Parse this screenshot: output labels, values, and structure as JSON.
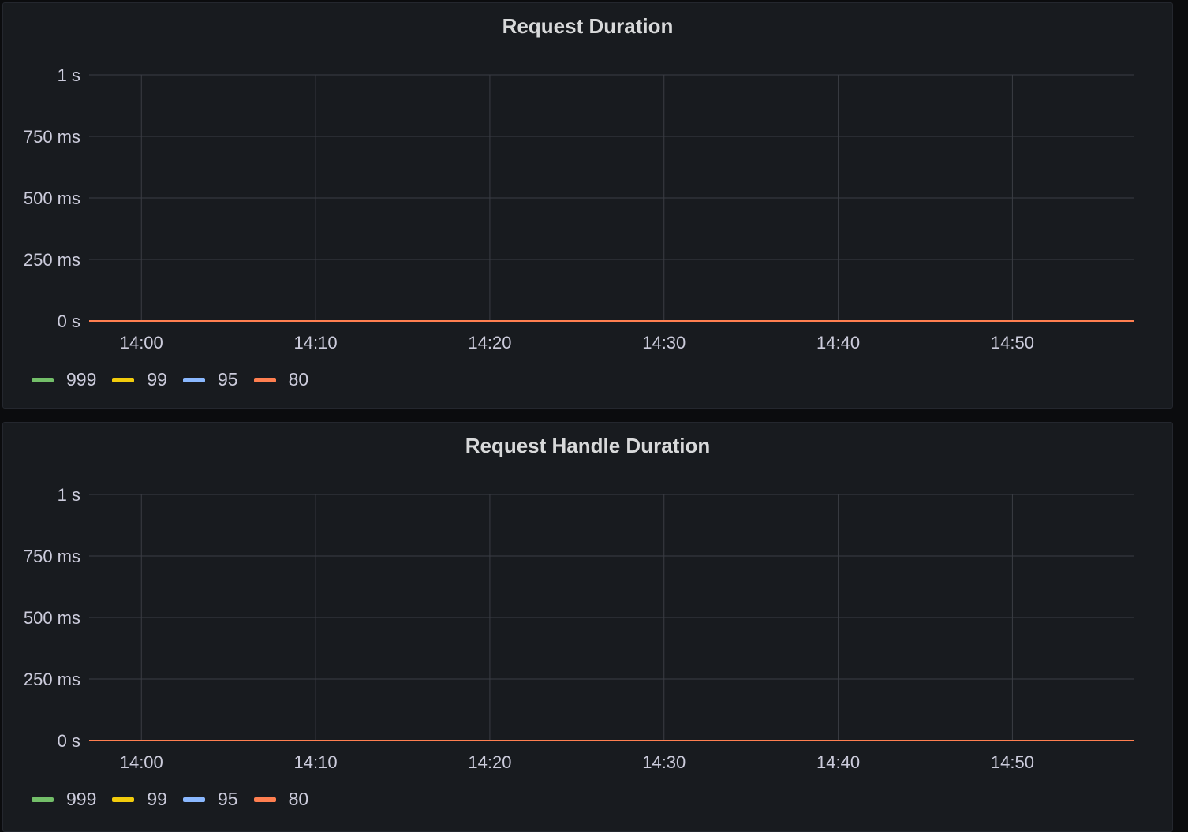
{
  "colors": {
    "background": "#0b0c0e",
    "panel_bg": "#181b1f",
    "grid": "#3a3d44",
    "text": "#ccccdc",
    "title": "#d8d9da"
  },
  "chart_data": [
    {
      "type": "line",
      "title": "Request Duration",
      "xlabel": "",
      "ylabel": "",
      "x_ticks": [
        "14:00",
        "14:10",
        "14:20",
        "14:30",
        "14:40",
        "14:50"
      ],
      "y_ticks": [
        "0 s",
        "250 ms",
        "500 ms",
        "750 ms",
        "1 s"
      ],
      "ylim": [
        0,
        1
      ],
      "x_range": [
        "13:57",
        "14:57"
      ],
      "grid": true,
      "legend_position": "bottom-left",
      "series": [
        {
          "name": "999",
          "color": "#73bf69",
          "x": [
            "13:57",
            "14:57"
          ],
          "values": [
            0,
            0
          ]
        },
        {
          "name": "99",
          "color": "#f2cc0c",
          "x": [
            "13:57",
            "14:57"
          ],
          "values": [
            0,
            0
          ]
        },
        {
          "name": "95",
          "color": "#8ab8ff",
          "x": [
            "13:57",
            "14:57"
          ],
          "values": [
            0,
            0
          ]
        },
        {
          "name": "80",
          "color": "#ff7f50",
          "x": [
            "13:57",
            "14:57"
          ],
          "values": [
            0,
            0
          ]
        }
      ]
    },
    {
      "type": "line",
      "title": "Request Handle Duration",
      "xlabel": "",
      "ylabel": "",
      "x_ticks": [
        "14:00",
        "14:10",
        "14:20",
        "14:30",
        "14:40",
        "14:50"
      ],
      "y_ticks": [
        "0 s",
        "250 ms",
        "500 ms",
        "750 ms",
        "1 s"
      ],
      "ylim": [
        0,
        1
      ],
      "x_range": [
        "13:57",
        "14:57"
      ],
      "grid": true,
      "legend_position": "bottom-left",
      "series": [
        {
          "name": "999",
          "color": "#73bf69",
          "x": [
            "13:57",
            "14:57"
          ],
          "values": [
            0,
            0
          ]
        },
        {
          "name": "99",
          "color": "#f2cc0c",
          "x": [
            "13:57",
            "14:57"
          ],
          "values": [
            0,
            0
          ]
        },
        {
          "name": "95",
          "color": "#8ab8ff",
          "x": [
            "13:57",
            "14:57"
          ],
          "values": [
            0,
            0
          ]
        },
        {
          "name": "80",
          "color": "#ff7f50",
          "x": [
            "13:57",
            "14:57"
          ],
          "values": [
            0,
            0
          ]
        }
      ]
    }
  ]
}
